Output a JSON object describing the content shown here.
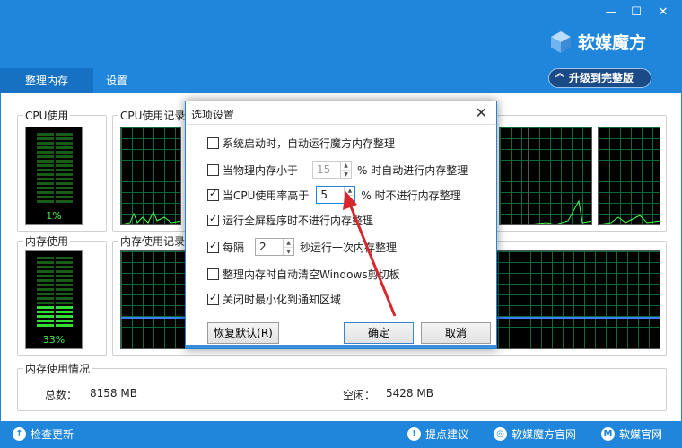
{
  "window": {
    "minimize_icon": "minimize-icon",
    "maximize_icon": "maximize-icon",
    "close_icon": "close-icon"
  },
  "brand": {
    "name": "软媒魔方",
    "logo_icon": "cube-logo-icon"
  },
  "upgrade_button": {
    "label": "升级到完整版",
    "icon": "double-chevron-up-icon"
  },
  "nav": {
    "tabs": [
      {
        "label": "整理内存"
      },
      {
        "label": "设置"
      }
    ]
  },
  "cpu": {
    "title": "CPU使用",
    "value_text": "1%",
    "level": 0.01
  },
  "cpu_history": {
    "title": "CPU使用记录"
  },
  "memory": {
    "title": "内存使用",
    "value_text": "33%",
    "level": 0.33
  },
  "memory_history": {
    "title": "内存使用记录"
  },
  "memory_info": {
    "title": "内存使用情况",
    "total_label": "总数：",
    "total_value": "8158 MB",
    "free_label": "空闲：",
    "free_value": "5428 MB"
  },
  "footer": {
    "check_update": "检查更新",
    "feedback": "提点建议",
    "official_site": "软媒魔方官网",
    "ruanmei_site": "软媒官网"
  },
  "dialog": {
    "title": "选项设置",
    "options": [
      {
        "label": "系统启动时，自动运行魔方内存整理",
        "checked": false
      },
      {
        "label_before": "当物理内存小于",
        "value": "15",
        "label_after": "% 时自动进行内存整理",
        "checked": false,
        "disabled": true
      },
      {
        "label_before": "当CPU使用率高于",
        "value": "5",
        "label_after": "% 时不进行内存整理",
        "checked": true
      },
      {
        "label": "运行全屏程序时不进行内存整理",
        "checked": true
      },
      {
        "label_before": "每隔",
        "value": "2",
        "label_after": "秒运行一次内存整理",
        "checked": true
      },
      {
        "label": "整理内存时自动清空Windows剪切板",
        "checked": false
      },
      {
        "label": "关闭时最小化到通知区域",
        "checked": true
      }
    ],
    "restore_defaults": "恢复默认(R)",
    "ok": "确定",
    "cancel": "取消"
  },
  "colors": {
    "header_blue": "#1f86dc",
    "active_tab": "#1671c2",
    "graph_grid": "#0f6a3a",
    "meter_on": "#33dd33",
    "meter_off": "#185c18",
    "annotation_arrow": "#d7262c"
  }
}
